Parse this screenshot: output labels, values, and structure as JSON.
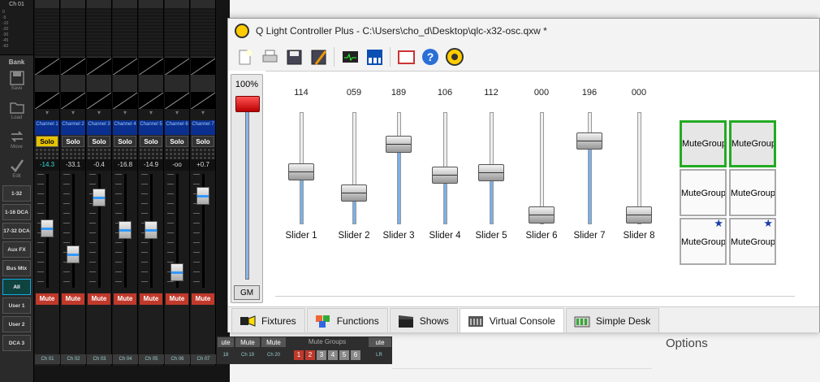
{
  "mixer": {
    "channel_label": "Ch 01",
    "scale": [
      "0",
      "-5",
      "-10",
      "-20",
      "-30",
      "-45",
      "-60"
    ],
    "bank_label": "Bank",
    "tools": [
      {
        "label": "Save",
        "icon": "save-icon"
      },
      {
        "label": "Load",
        "icon": "folder-icon"
      },
      {
        "label": "Move",
        "icon": "move-arrows-icon"
      },
      {
        "label": "Edit",
        "icon": "checkmark-icon"
      }
    ],
    "banks": [
      "1-32",
      "1-16 DCA",
      "17-32 DCA",
      "Aux FX",
      "Bus Mtx",
      "All",
      "User 1",
      "User 2",
      "DCA 3"
    ],
    "strips": [
      {
        "name": "Channel 1",
        "solo": "Solo",
        "db": "-14.3",
        "foot": "Ch 01",
        "mute": "Mute",
        "solo_on": true
      },
      {
        "name": "Channel 2",
        "solo": "Solo",
        "db": "-33.1",
        "foot": "Ch 02",
        "mute": "Mute",
        "solo_on": false
      },
      {
        "name": "Channel 3",
        "solo": "Solo",
        "db": "-0.4",
        "foot": "Ch 03",
        "mute": "Mute",
        "solo_on": false
      },
      {
        "name": "Channel 4",
        "solo": "Solo",
        "db": "-16.8",
        "foot": "Ch 04",
        "mute": "Mute",
        "solo_on": false
      },
      {
        "name": "Channel 5",
        "solo": "Solo",
        "db": "-14.9",
        "foot": "Ch 05",
        "mute": "Mute",
        "solo_on": false
      },
      {
        "name": "Channel 6",
        "solo": "Solo",
        "db": "-oo",
        "foot": "Ch 06",
        "mute": "Mute",
        "solo_on": false
      },
      {
        "name": "Channel 7",
        "solo": "Solo",
        "db": "+0.7",
        "foot": "Ch 07",
        "mute": "Mute",
        "solo_on": false
      }
    ],
    "bottom": {
      "mute_groups": "Mute Groups",
      "groups": [
        "1",
        "2",
        "3",
        "4",
        "5",
        "6"
      ],
      "feet": [
        "18",
        "Ch 19",
        "Ch 20",
        "LR"
      ],
      "mutes": [
        "ute",
        "Mute",
        "Mute",
        "ute"
      ]
    }
  },
  "qlc": {
    "title": "Q Light Controller Plus - C:\\Users\\cho_d\\Desktop\\qlc-x32-osc.qxw *",
    "toolbar": [
      "new-icon",
      "print-icon",
      "save-icon",
      "save-as-icon",
      "monitor-icon",
      "dmx-icon",
      "fullscreen-icon",
      "help-icon",
      "about-icon"
    ],
    "grand_master": {
      "percent": "100%",
      "button": "GM",
      "level": 100
    },
    "sliders": [
      {
        "label": "Slider 1",
        "value": "114",
        "level": 114
      },
      {
        "label": "Slider 2",
        "value": "059",
        "level": 59
      },
      {
        "label": "Slider 3",
        "value": "189",
        "level": 189
      },
      {
        "label": "Slider 4",
        "value": "106",
        "level": 106
      },
      {
        "label": "Slider 5",
        "value": "112",
        "level": 112
      },
      {
        "label": "Slider 6",
        "value": "000",
        "level": 0
      },
      {
        "label": "Slider 7",
        "value": "196",
        "level": 196
      },
      {
        "label": "Slider 8",
        "value": "000",
        "level": 0
      }
    ],
    "mute_groups": [
      {
        "label": "MuteGroup",
        "on": true,
        "star": false
      },
      {
        "label": "MuteGroup",
        "on": true,
        "star": false
      },
      {
        "label": "MuteGroup",
        "on": false,
        "star": false
      },
      {
        "label": "MuteGroup",
        "on": false,
        "star": false
      },
      {
        "label": "MuteGroup",
        "on": false,
        "star": true
      },
      {
        "label": "MuteGroup",
        "on": false,
        "star": true
      }
    ],
    "tabs": [
      {
        "label": "Fixtures",
        "icon": "fixtures-icon",
        "selected": false
      },
      {
        "label": "Functions",
        "icon": "functions-icon",
        "selected": false
      },
      {
        "label": "Shows",
        "icon": "clapperboard-icon",
        "selected": false
      },
      {
        "label": "Virtual Console",
        "icon": "console-icon",
        "selected": true
      },
      {
        "label": "Simple Desk",
        "icon": "desk-icon",
        "selected": false
      }
    ]
  },
  "background": {
    "options_label": "Options"
  },
  "colors": {
    "accent": "#7ab0e8",
    "mute": "#c0392b",
    "solo": "#e6c200",
    "active_group": "#22aa22",
    "star": "#1a3ea8"
  }
}
